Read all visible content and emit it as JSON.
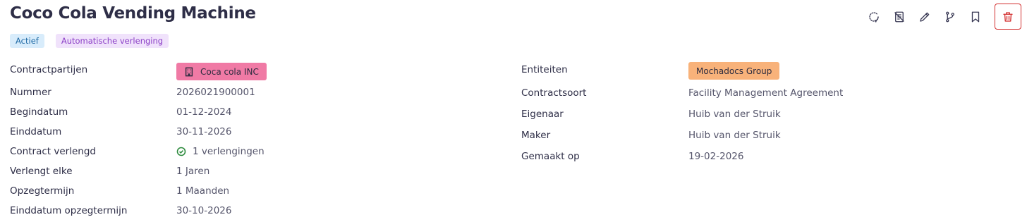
{
  "header": {
    "title": "Coco Cola Vending Machine",
    "badges": {
      "status": "Actief",
      "renewal": "Automatische verlenging"
    }
  },
  "toolbar": {
    "icons": [
      "refresh-icon",
      "document-icon",
      "pencil-icon",
      "branch-icon",
      "bookmark-icon",
      "trash-icon"
    ]
  },
  "details_left": {
    "contract_parties": {
      "label": "Contractpartijen",
      "value": "Coca cola INC"
    },
    "number": {
      "label": "Nummer",
      "value": "2026021900001"
    },
    "start_date": {
      "label": "Begindatum",
      "value": "01-12-2024"
    },
    "end_date": {
      "label": "Einddatum",
      "value": "30-11-2026"
    },
    "renewed": {
      "label": "Contract verlengd",
      "value": "1 verlengingen"
    },
    "renews_every": {
      "label": "Verlengt elke",
      "value": "1 Jaren"
    },
    "notice_period": {
      "label": "Opzegtermijn",
      "value": "1 Maanden"
    },
    "notice_end_date": {
      "label": "Einddatum opzegtermijn",
      "value": "30-10-2026"
    }
  },
  "details_right": {
    "entities": {
      "label": "Entiteiten",
      "value": "Mochadocs Group"
    },
    "contract_type": {
      "label": "Contractsoort",
      "value": "Facility Management Agreement"
    },
    "owner": {
      "label": "Eigenaar",
      "value": "Huib van der Struik"
    },
    "creator": {
      "label": "Maker",
      "value": "Huib van der Struik"
    },
    "created_on": {
      "label": "Gemaakt op",
      "value": "19-02-2026"
    }
  },
  "colors": {
    "party_chip": "#f07aa5",
    "entity_chip": "#f8b27a",
    "delete": "#d32f2f",
    "check": "#2e8b3e"
  }
}
